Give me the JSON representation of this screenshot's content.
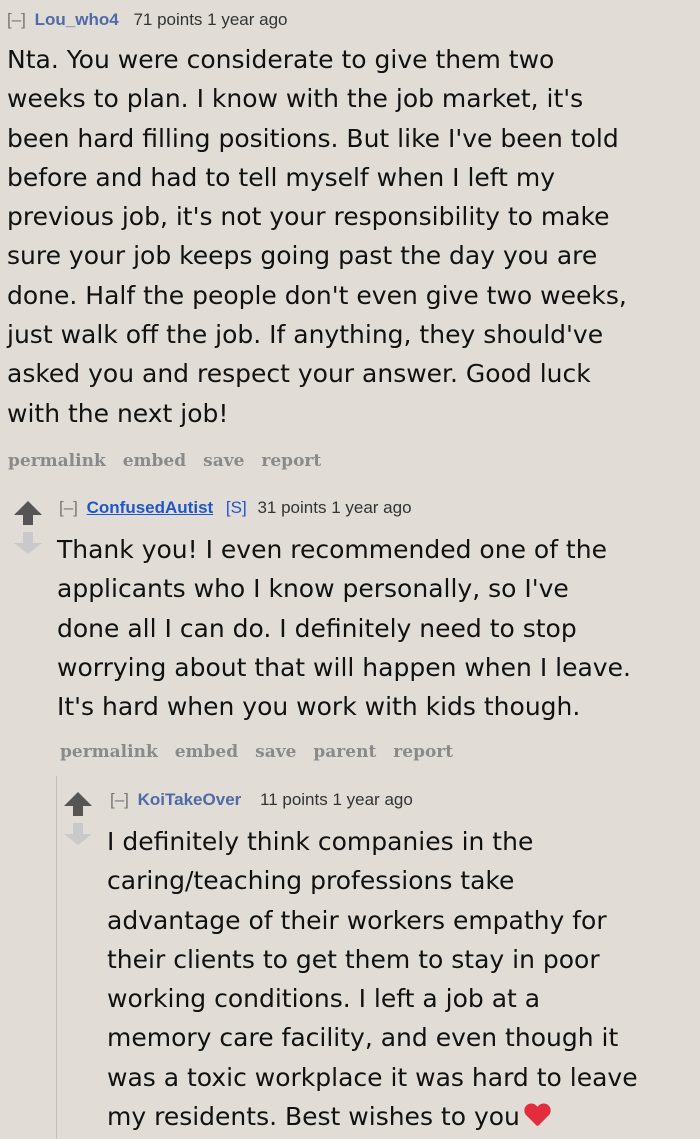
{
  "comments": [
    {
      "toggle": "[–]",
      "author": "Lou_who4",
      "score": "71 points",
      "time": "1 year ago",
      "body": "Nta. You were considerate to give them two\nweeks to plan. I know with the job market, it's\nbeen hard filling positions. But like I've been told\nbefore and had to tell myself when I left my\nprevious job, it's not your responsibility to make\nsure your job keeps going past the day you are\ndone. Half the people don't even give two weeks,\njust walk off the job. If anything, they should've\nasked you and respect your answer. Good luck\nwith the next job!",
      "buttons": [
        "permalink",
        "embed",
        "save",
        "report"
      ]
    },
    {
      "toggle": "[–]",
      "author": "ConfusedAutist",
      "flair": "[S]",
      "score": "31 points",
      "time": "1 year ago",
      "body": "Thank you! I even recommended one of the\napplicants who I know personally, so I've\ndone all I can do. I definitely need to stop\nworrying about that will happen when I leave.\nIt's hard when you work with kids though.",
      "buttons": [
        "permalink",
        "embed",
        "save",
        "parent",
        "report"
      ]
    },
    {
      "toggle": "[–]",
      "author": "KoiTakeOver",
      "score": "11 points",
      "time": "1 year ago",
      "body": "I definitely think companies in the\ncaring/teaching professions take\nadvantage of their workers empathy for\ntheir clients to get them to stay in poor\nworking conditions. I left a job at a\nmemory care facility, and even though it\nwas a toxic workplace it was hard to leave\nmy residents. Best wishes to you",
      "emoji": "red-heart"
    }
  ]
}
